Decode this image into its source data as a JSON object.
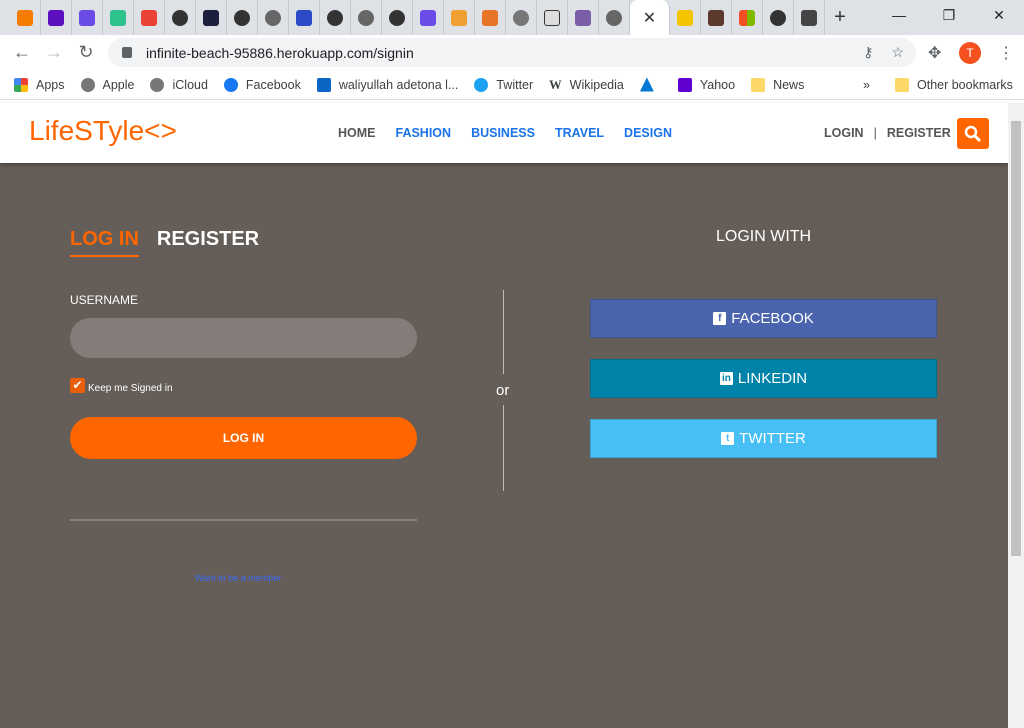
{
  "browser": {
    "url": "infinite-beach-95886.herokuapp.com/signin",
    "profile_initial": "T",
    "bookmarks": [
      "Apps",
      "Apple",
      "iCloud",
      "Facebook",
      "waliyullah adetona l...",
      "Twitter",
      "Wikipedia",
      "",
      "Yahoo",
      "News"
    ],
    "other_bookmarks": "Other bookmarks",
    "overflow": "»"
  },
  "site": {
    "logo": "LifeSTyle<>",
    "nav": [
      "HOME",
      "FASHION",
      "BUSINESS",
      "TRAVEL",
      "DESIGN"
    ],
    "login": "LOGIN",
    "separator": "|",
    "register": "REGISTER"
  },
  "form": {
    "tab_login": "LOG IN",
    "tab_register": "REGISTER",
    "username_label": "USERNAME",
    "username_value": "",
    "keep_signed": "Keep me Signed in",
    "keep_checked": true,
    "login_button": "LOG IN",
    "member_link": "Want to be a member"
  },
  "social": {
    "or": "or",
    "title": "LOGIN WITH",
    "buttons": [
      {
        "label": "FACEBOOK",
        "color": "#4a64ad"
      },
      {
        "label": "LINKEDIN",
        "color": "#0083a8"
      },
      {
        "label": "TWITTER",
        "color": "#47bff5"
      }
    ]
  },
  "colors": {
    "accent": "#ff6600",
    "background": "#655d57"
  }
}
